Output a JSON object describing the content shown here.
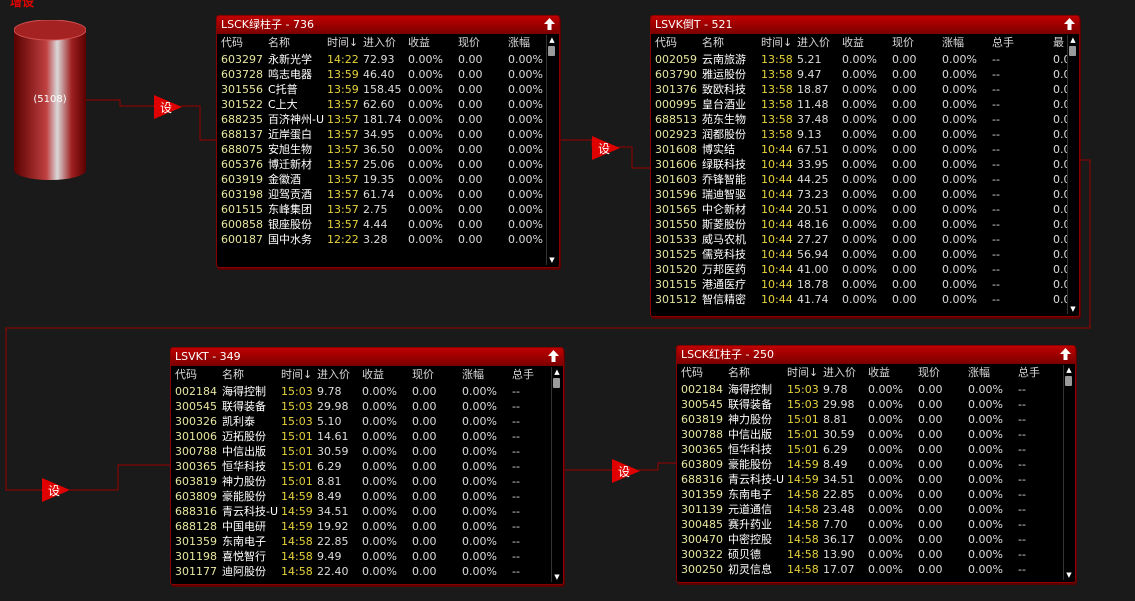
{
  "top_label": "增设",
  "source": {
    "count": "(5108)"
  },
  "set_label": "设",
  "columns_a": [
    "代码",
    "名称",
    "时间↓",
    "进入价",
    "收益",
    "现价",
    "涨幅"
  ],
  "columns_b": [
    "代码",
    "名称",
    "时间↓",
    "进入价",
    "收益",
    "现价",
    "涨幅",
    "总手",
    "最"
  ],
  "columns_c": [
    "代码",
    "名称",
    "时间↓",
    "进入价",
    "收益",
    "现价",
    "涨幅",
    "总手"
  ],
  "panels": {
    "green": {
      "title": "LSCK绿柱子 - 736",
      "rows": [
        [
          "603297",
          "永新光学",
          "14:22",
          "72.93",
          "0.00%",
          "0.00",
          "0.00%"
        ],
        [
          "603728",
          "鸣志电器",
          "13:59",
          "46.40",
          "0.00%",
          "0.00",
          "0.00%"
        ],
        [
          "301556",
          "C托普",
          "13:59",
          "158.45",
          "0.00%",
          "0.00",
          "0.00%"
        ],
        [
          "301522",
          "C上大",
          "13:57",
          "62.60",
          "0.00%",
          "0.00",
          "0.00%"
        ],
        [
          "688235",
          "百济神州-U",
          "13:57",
          "181.74",
          "0.00%",
          "0.00",
          "0.00%"
        ],
        [
          "688137",
          "近岸蛋白",
          "13:57",
          "34.95",
          "0.00%",
          "0.00",
          "0.00%"
        ],
        [
          "688075",
          "安旭生物",
          "13:57",
          "36.50",
          "0.00%",
          "0.00",
          "0.00%"
        ],
        [
          "605376",
          "博迁新材",
          "13:57",
          "25.06",
          "0.00%",
          "0.00",
          "0.00%"
        ],
        [
          "603919",
          "金徽酒",
          "13:57",
          "19.35",
          "0.00%",
          "0.00",
          "0.00%"
        ],
        [
          "603198",
          "迎驾贡酒",
          "13:57",
          "61.74",
          "0.00%",
          "0.00",
          "0.00%"
        ],
        [
          "601515",
          "东峰集团",
          "13:57",
          "2.75",
          "0.00%",
          "0.00",
          "0.00%"
        ],
        [
          "600858",
          "银座股份",
          "13:57",
          "4.44",
          "0.00%",
          "0.00",
          "0.00%"
        ],
        [
          "600187",
          "国中水务",
          "12:22",
          "3.28",
          "0.00%",
          "0.00",
          "0.00%"
        ]
      ]
    },
    "fall": {
      "title": "LSVK倒T - 521",
      "rows": [
        [
          "002059",
          "云南旅游",
          "13:58",
          "5.21",
          "0.00%",
          "0.00",
          "0.00%",
          "--",
          "0.0"
        ],
        [
          "603790",
          "雅运股份",
          "13:58",
          "9.47",
          "0.00%",
          "0.00",
          "0.00%",
          "--",
          "0.0"
        ],
        [
          "301376",
          "致欧科技",
          "13:58",
          "18.87",
          "0.00%",
          "0.00",
          "0.00%",
          "--",
          "0.0"
        ],
        [
          "000995",
          "皇台酒业",
          "13:58",
          "11.48",
          "0.00%",
          "0.00",
          "0.00%",
          "--",
          "0.0"
        ],
        [
          "688513",
          "苑东生物",
          "13:58",
          "37.48",
          "0.00%",
          "0.00",
          "0.00%",
          "--",
          "0.0"
        ],
        [
          "002923",
          "润都股份",
          "13:58",
          "9.13",
          "0.00%",
          "0.00",
          "0.00%",
          "--",
          "0.0"
        ],
        [
          "301608",
          "博实结",
          "10:44",
          "67.51",
          "0.00%",
          "0.00",
          "0.00%",
          "--",
          "0.0"
        ],
        [
          "301606",
          "绿联科技",
          "10:44",
          "33.95",
          "0.00%",
          "0.00",
          "0.00%",
          "--",
          "0.0"
        ],
        [
          "301603",
          "乔锋智能",
          "10:44",
          "44.25",
          "0.00%",
          "0.00",
          "0.00%",
          "--",
          "0.0"
        ],
        [
          "301596",
          "瑞迪智驱",
          "10:44",
          "73.23",
          "0.00%",
          "0.00",
          "0.00%",
          "--",
          "0.0"
        ],
        [
          "301565",
          "中仑新材",
          "10:44",
          "20.51",
          "0.00%",
          "0.00",
          "0.00%",
          "--",
          "0.0"
        ],
        [
          "301550",
          "斯菱股份",
          "10:44",
          "48.16",
          "0.00%",
          "0.00",
          "0.00%",
          "--",
          "0.0"
        ],
        [
          "301533",
          "威马农机",
          "10:44",
          "27.27",
          "0.00%",
          "0.00",
          "0.00%",
          "--",
          "0.0"
        ],
        [
          "301525",
          "儒竞科技",
          "10:44",
          "56.94",
          "0.00%",
          "0.00",
          "0.00%",
          "--",
          "0.0"
        ],
        [
          "301520",
          "万邦医药",
          "10:44",
          "41.00",
          "0.00%",
          "0.00",
          "0.00%",
          "--",
          "0.0"
        ],
        [
          "301515",
          "港通医疗",
          "10:44",
          "18.78",
          "0.00%",
          "0.00",
          "0.00%",
          "--",
          "0.0"
        ],
        [
          "301512",
          "智信精密",
          "10:44",
          "41.74",
          "0.00%",
          "0.00",
          "0.00%",
          "--",
          "0.0"
        ]
      ]
    },
    "vkt": {
      "title": "LSVKT - 349",
      "rows": [
        [
          "002184",
          "海得控制",
          "15:03",
          "9.78",
          "0.00%",
          "0.00",
          "0.00%",
          "--"
        ],
        [
          "300545",
          "联得装备",
          "15:03",
          "29.98",
          "0.00%",
          "0.00",
          "0.00%",
          "--"
        ],
        [
          "300326",
          "凯利泰",
          "15:03",
          "5.10",
          "0.00%",
          "0.00",
          "0.00%",
          "--"
        ],
        [
          "301006",
          "迈拓股份",
          "15:01",
          "14.61",
          "0.00%",
          "0.00",
          "0.00%",
          "--"
        ],
        [
          "300788",
          "中信出版",
          "15:01",
          "30.59",
          "0.00%",
          "0.00",
          "0.00%",
          "--"
        ],
        [
          "300365",
          "恒华科技",
          "15:01",
          "6.29",
          "0.00%",
          "0.00",
          "0.00%",
          "--"
        ],
        [
          "603819",
          "神力股份",
          "15:01",
          "8.81",
          "0.00%",
          "0.00",
          "0.00%",
          "--"
        ],
        [
          "603809",
          "豪能股份",
          "14:59",
          "8.49",
          "0.00%",
          "0.00",
          "0.00%",
          "--"
        ],
        [
          "688316",
          "青云科技-U",
          "14:59",
          "34.51",
          "0.00%",
          "0.00",
          "0.00%",
          "--"
        ],
        [
          "688128",
          "中国电研",
          "14:59",
          "19.92",
          "0.00%",
          "0.00",
          "0.00%",
          "--"
        ],
        [
          "301359",
          "东南电子",
          "14:58",
          "22.85",
          "0.00%",
          "0.00",
          "0.00%",
          "--"
        ],
        [
          "301198",
          "喜悦智行",
          "14:58",
          "9.49",
          "0.00%",
          "0.00",
          "0.00%",
          "--"
        ],
        [
          "301177",
          "迪阿股份",
          "14:58",
          "22.40",
          "0.00%",
          "0.00",
          "0.00%",
          "--"
        ]
      ]
    },
    "red": {
      "title": "LSCK红柱子 - 250",
      "rows": [
        [
          "002184",
          "海得控制",
          "15:03",
          "9.78",
          "0.00%",
          "0.00",
          "0.00%",
          "--"
        ],
        [
          "300545",
          "联得装备",
          "15:03",
          "29.98",
          "0.00%",
          "0.00",
          "0.00%",
          "--"
        ],
        [
          "603819",
          "神力股份",
          "15:01",
          "8.81",
          "0.00%",
          "0.00",
          "0.00%",
          "--"
        ],
        [
          "300788",
          "中信出版",
          "15:01",
          "30.59",
          "0.00%",
          "0.00",
          "0.00%",
          "--"
        ],
        [
          "300365",
          "恒华科技",
          "15:01",
          "6.29",
          "0.00%",
          "0.00",
          "0.00%",
          "--"
        ],
        [
          "603809",
          "豪能股份",
          "14:59",
          "8.49",
          "0.00%",
          "0.00",
          "0.00%",
          "--"
        ],
        [
          "688316",
          "青云科技-U",
          "14:59",
          "34.51",
          "0.00%",
          "0.00",
          "0.00%",
          "--"
        ],
        [
          "301359",
          "东南电子",
          "14:58",
          "22.85",
          "0.00%",
          "0.00",
          "0.00%",
          "--"
        ],
        [
          "301139",
          "元道通信",
          "14:58",
          "23.48",
          "0.00%",
          "0.00",
          "0.00%",
          "--"
        ],
        [
          "300485",
          "赛升药业",
          "14:58",
          "7.70",
          "0.00%",
          "0.00",
          "0.00%",
          "--"
        ],
        [
          "300470",
          "中密控股",
          "14:58",
          "36.17",
          "0.00%",
          "0.00",
          "0.00%",
          "--"
        ],
        [
          "300322",
          "硕贝德",
          "14:58",
          "13.90",
          "0.00%",
          "0.00",
          "0.00%",
          "--"
        ],
        [
          "300250",
          "初灵信息",
          "14:58",
          "17.07",
          "0.00%",
          "0.00",
          "0.00%",
          "--"
        ]
      ]
    }
  }
}
